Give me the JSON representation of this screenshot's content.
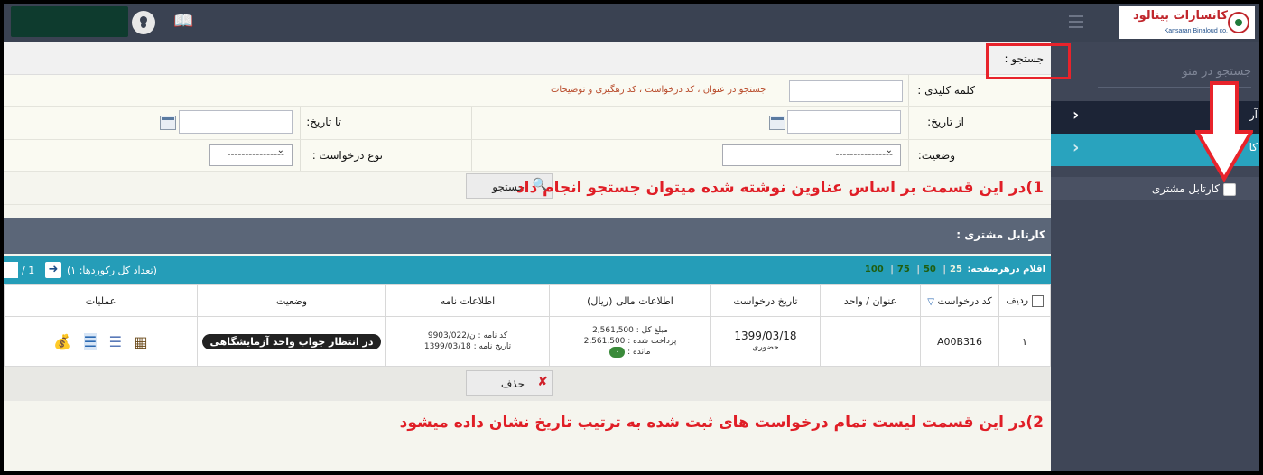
{
  "topbar": {
    "brand_name": "کانسارات بینالود",
    "brand_sub": "Kansaran Binaloud co."
  },
  "sidebar": {
    "search_placeholder": "جستجو در منو",
    "item1_edge": "آر",
    "item2_edge": "کا",
    "customer_cart": "کارتابل مشتری"
  },
  "search": {
    "header": "جستجو :",
    "keyword_label": "کلمه کلیدی :",
    "keyword_hint": "جستجو در عنوان ، کد درخواست ، کد رهگیری و توضیحات",
    "from_date_label": "از تاریخ:",
    "to_date_label": "تا تاریخ:",
    "status_label": "وضعیت:",
    "status_value": "----------------",
    "req_type_label": "نوع درخواست :",
    "req_type_value": "----------------",
    "search_button": "جستجو"
  },
  "annotations": {
    "note1": "1)در این قسمت بر اساس عناوین نوشته شده میتوان جستجو انجام داد",
    "note2": "2)در این قسمت لیست تمام درخواست های ثبت شده به ترتیب تاریخ نشان داده میشود"
  },
  "cartable": {
    "title": "کارتابل مشتری :",
    "per_page_label": "اقلام درهرصفحه:",
    "per_page_options": [
      "25",
      "50",
      "75",
      "100"
    ],
    "total_records": "(تعداد کل رکوردها: ۱)",
    "page_of": "/ 1",
    "columns": [
      "ردیف",
      "کد درخواست",
      "عنوان / واحد",
      "تاریخ درخواست",
      "اطلاعات مالی (ریال)",
      "اطلاعات نامه",
      "وضعیت",
      "عملیات"
    ],
    "row": {
      "index": "۱",
      "code": "A00B316",
      "title": "",
      "date": "1399/03/18",
      "date_sub": "حضوری",
      "fin_total": "مبلغ کل : 2,561,500",
      "fin_paid": "پرداخت شده : 2,561,500",
      "fin_remain_label": "مانده :",
      "fin_remain": "۰",
      "letter_code": "کد نامه : ن/9903/022",
      "letter_date": "تاریخ نامه : 1399/03/18",
      "status": "در انتظار جواب واحد آزمایشگاهی"
    },
    "delete_button": "حذف"
  },
  "colors": {
    "topbar": "#3a4252",
    "sidebar": "#3f4657",
    "accent_teal": "#259db8",
    "annotation_red": "#e01e26"
  }
}
